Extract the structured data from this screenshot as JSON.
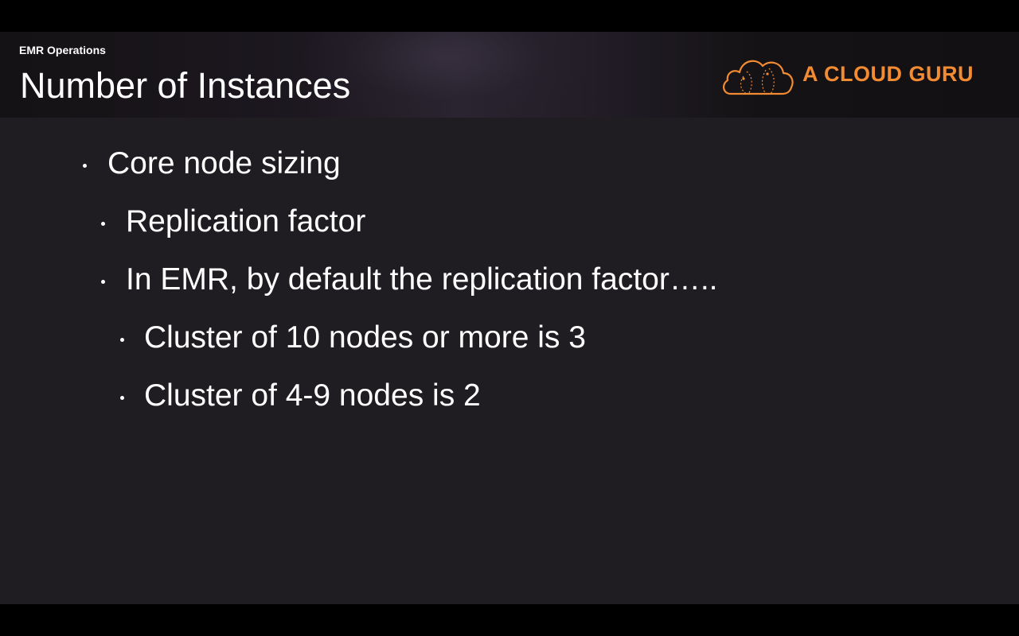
{
  "header": {
    "section_label": "EMR Operations",
    "title": "Number of Instances",
    "logo_text": "A CLOUD GURU",
    "brand_color": "#f28b32"
  },
  "bullets": [
    {
      "level": 1,
      "text": "Core node sizing"
    },
    {
      "level": 2,
      "text": "Replication factor"
    },
    {
      "level": 2,
      "text": "In EMR, by default the replication factor….."
    },
    {
      "level": 3,
      "text": "Cluster of 10 nodes or more is 3"
    },
    {
      "level": 3,
      "text": "Cluster of 4-9 nodes is 2"
    }
  ]
}
